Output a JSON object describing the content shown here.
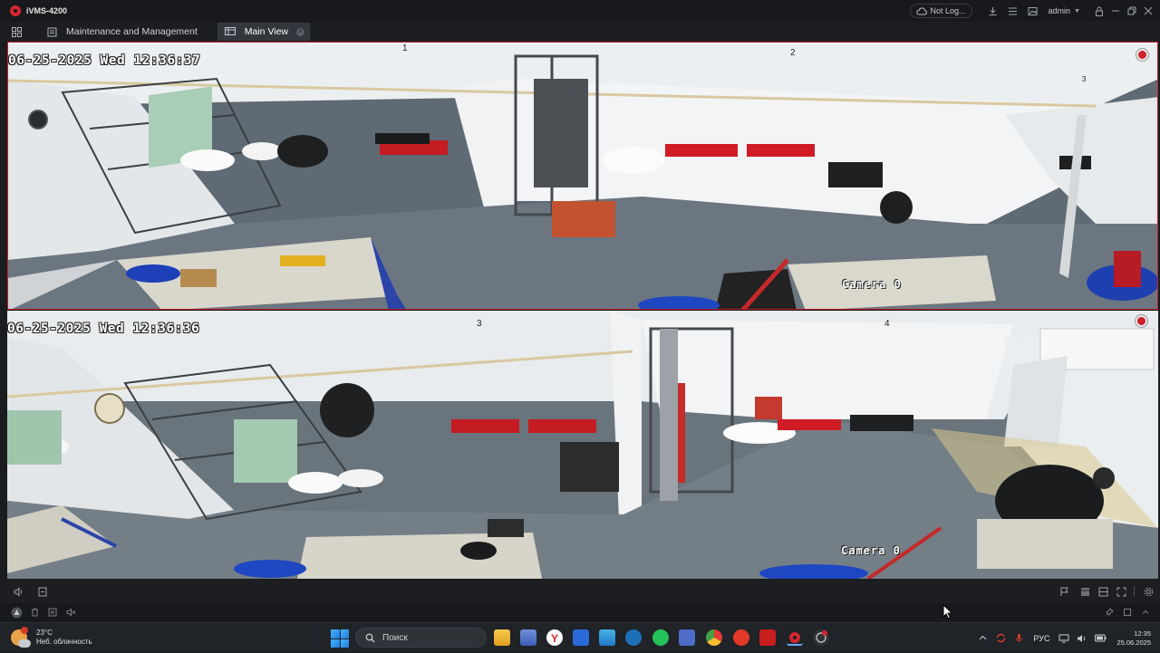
{
  "app": {
    "title": "iVMS-4200"
  },
  "titlebar": {
    "cloud_status": "Not Log...",
    "user": "admin"
  },
  "tabs": [
    {
      "label": "Maintenance and Management"
    },
    {
      "label": "Main View"
    }
  ],
  "cameras": [
    {
      "window": "1",
      "timestamp": "06-25-2025 Wed 12:36:37",
      "window2": "2",
      "window3": "3",
      "name": "Camera 0",
      "recording": true
    },
    {
      "window": "3",
      "timestamp": "06-25-2025 Wed 12:36:36",
      "window2": "4",
      "name": "Camera 0",
      "recording": true
    }
  ],
  "taskbar": {
    "weather_temp": "23°C",
    "weather_desc": "Неб. облачность",
    "search_placeholder": "Поиск",
    "language": "РУС",
    "time": "12:35",
    "date": "25.06.2025"
  },
  "colors": {
    "accent": "#c4232c",
    "background": "#1a1c20"
  }
}
